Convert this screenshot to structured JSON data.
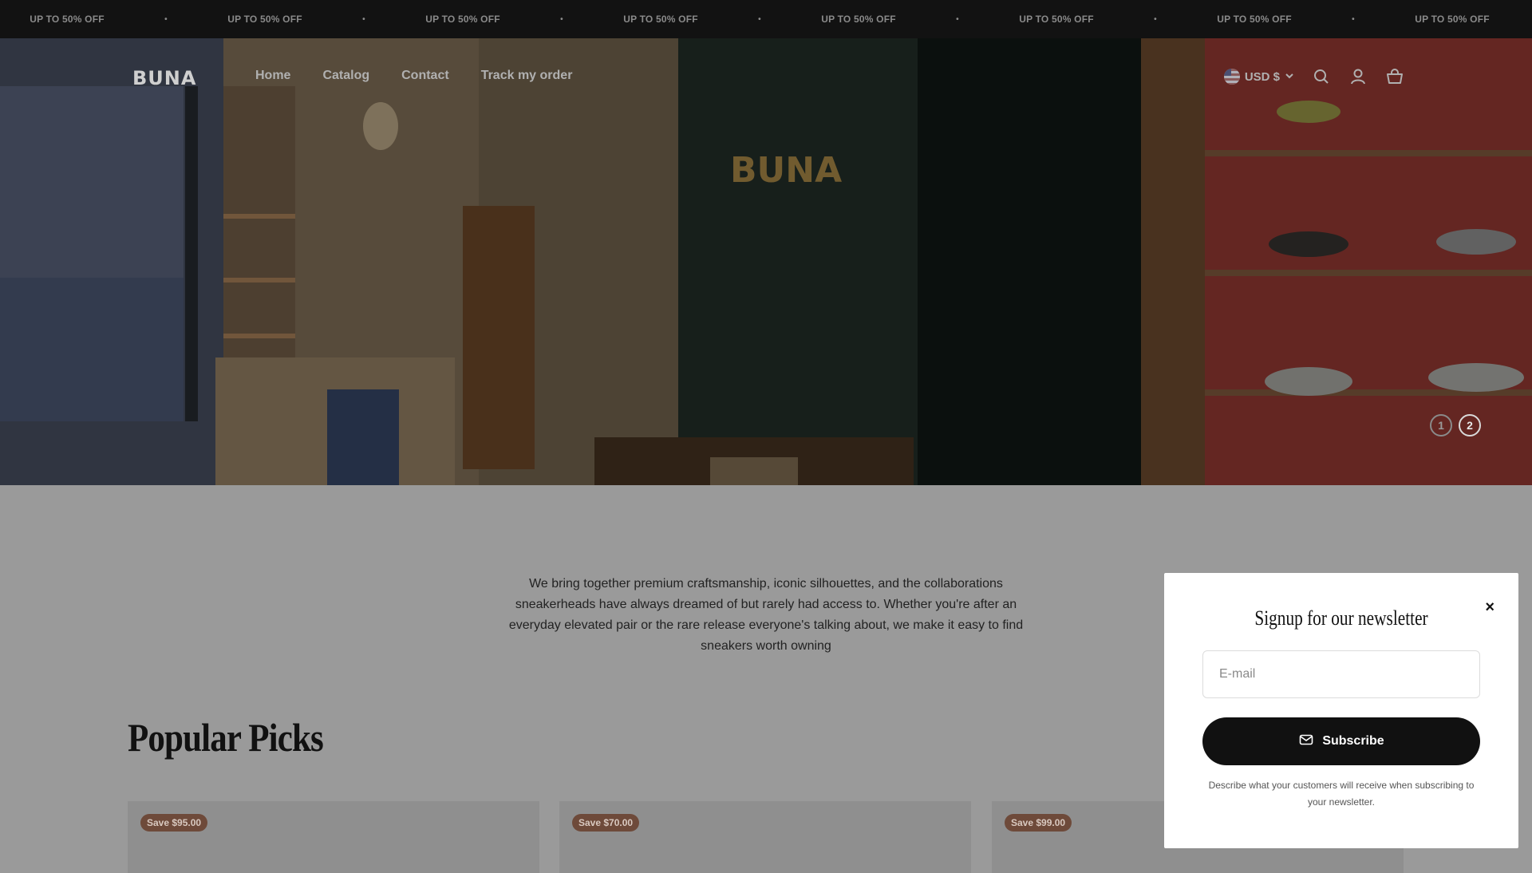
{
  "announcement": {
    "text": "UP TO 50% OFF",
    "separator": "•"
  },
  "header": {
    "logo": "BUNA",
    "nav": [
      "Home",
      "Catalog",
      "Contact",
      "Track my order"
    ],
    "currency": "USD $",
    "icons": [
      "search-icon",
      "account-icon",
      "cart-icon"
    ]
  },
  "hero": {
    "sign": "BUNA",
    "slides": [
      "1",
      "2"
    ],
    "active_slide": "2"
  },
  "about": {
    "text": "We bring together premium craftsmanship, iconic silhouettes, and the collaborations sneakerheads have always dreamed of but rarely had access to. Whether you're after an everyday elevated pair or the rare release everyone's talking about, we make it easy to find sneakers worth owning"
  },
  "popular": {
    "title": "Popular Picks",
    "cards": [
      {
        "badge": "Save $95.00"
      },
      {
        "badge": "Save $70.00"
      },
      {
        "badge": "Save $99.00"
      }
    ]
  },
  "newsletter": {
    "title": "Signup for our newsletter",
    "email_placeholder": "E-mail",
    "button_label": "Subscribe",
    "description": "Describe what your customers will receive when subscribing to your newsletter.",
    "close": "×"
  },
  "colors": {
    "overlay": "#9a9a9a",
    "dark": "#111111",
    "badge": "#6e4a3a",
    "accent_red": "#8a3a34"
  }
}
